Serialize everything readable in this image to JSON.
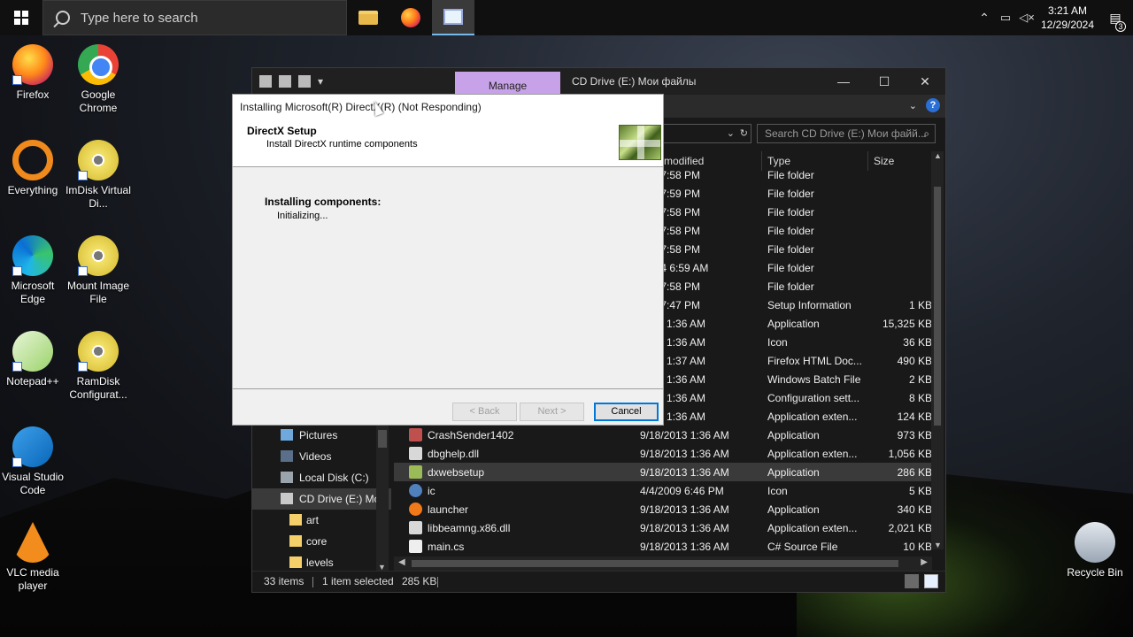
{
  "taskbar": {
    "search_placeholder": "Type here to search",
    "time": "3:21 AM",
    "date": "12/29/2024",
    "notification_count": "3"
  },
  "desktop_icons": [
    {
      "label": "Firefox",
      "icon": "firefox-icon"
    },
    {
      "label": "Google Chrome",
      "icon": "chrome-icon"
    },
    {
      "label": "Everything",
      "icon": "everything-icon"
    },
    {
      "label": "ImDisk Virtual Di...",
      "icon": "disc-icon"
    },
    {
      "label": "Microsoft Edge",
      "icon": "edge-icon"
    },
    {
      "label": "Mount Image File",
      "icon": "disc-icon"
    },
    {
      "label": "Notepad++",
      "icon": "notepad-icon"
    },
    {
      "label": "RamDisk Configurat...",
      "icon": "disc-icon"
    },
    {
      "label": "Visual Studio Code",
      "icon": "vscode-icon"
    },
    {
      "label": "VLC media player",
      "icon": "vlc-icon"
    },
    {
      "label": "Recycle Bin",
      "icon": "recycle-bin-icon"
    }
  ],
  "explorer": {
    "manage_tab": "Manage",
    "title": "CD Drive (E:) Мои файлы",
    "search_placeholder": "Search CD Drive (E:) Мои файй...",
    "columns": {
      "modified": "modified",
      "type": "Type",
      "size": "Size"
    },
    "files": [
      {
        "name": "",
        "date": "021 7:58 PM",
        "type": "File folder",
        "size": ""
      },
      {
        "name": "",
        "date": "021 7:59 PM",
        "type": "File folder",
        "size": ""
      },
      {
        "name": "",
        "date": "021 7:58 PM",
        "type": "File folder",
        "size": ""
      },
      {
        "name": "",
        "date": "021 7:58 PM",
        "type": "File folder",
        "size": ""
      },
      {
        "name": "",
        "date": "021 7:58 PM",
        "type": "File folder",
        "size": ""
      },
      {
        "name": "",
        "date": "/2024 6:59 AM",
        "type": "File folder",
        "size": ""
      },
      {
        "name": "",
        "date": "021 7:58 PM",
        "type": "File folder",
        "size": ""
      },
      {
        "name": "",
        "date": "021 7:47 PM",
        "type": "Setup Information",
        "size": "1 KB"
      },
      {
        "name": "",
        "date": "2013 1:36 AM",
        "type": "Application",
        "size": "15,325 KB"
      },
      {
        "name": "",
        "date": "2013 1:36 AM",
        "type": "Icon",
        "size": "36 KB"
      },
      {
        "name": "",
        "date": "2013 1:37 AM",
        "type": "Firefox HTML Doc...",
        "size": "490 KB"
      },
      {
        "name": "",
        "date": "2013 1:36 AM",
        "type": "Windows Batch File",
        "size": "2 KB"
      },
      {
        "name": "",
        "date": "2013 1:36 AM",
        "type": "Configuration sett...",
        "size": "8 KB"
      },
      {
        "name": "",
        "date": "2013 1:36 AM",
        "type": "Application exten...",
        "size": "124 KB"
      },
      {
        "name": "CrashSender1402",
        "date": "9/18/2013 1:36 AM",
        "type": "Application",
        "size": "973 KB"
      },
      {
        "name": "dbghelp.dll",
        "date": "9/18/2013 1:36 AM",
        "type": "Application exten...",
        "size": "1,056 KB"
      },
      {
        "name": "dxwebsetup",
        "date": "9/18/2013 1:36 AM",
        "type": "Application",
        "size": "286 KB"
      },
      {
        "name": "ic",
        "date": "4/4/2009 6:46 PM",
        "type": "Icon",
        "size": "5 KB"
      },
      {
        "name": "launcher",
        "date": "9/18/2013 1:36 AM",
        "type": "Application",
        "size": "340 KB"
      },
      {
        "name": "libbeamng.x86.dll",
        "date": "9/18/2013 1:36 AM",
        "type": "Application exten...",
        "size": "2,021 KB"
      },
      {
        "name": "main.cs",
        "date": "9/18/2013 1:36 AM",
        "type": "C# Source File",
        "size": "10 KB"
      }
    ],
    "nav": [
      {
        "label": "Pictures"
      },
      {
        "label": "Videos"
      },
      {
        "label": "Local Disk (C:)"
      },
      {
        "label": "CD Drive (E:) Mo"
      },
      {
        "label": "art"
      },
      {
        "label": "core"
      },
      {
        "label": "levels"
      }
    ],
    "status": {
      "count": "33 items",
      "selected": "1 item selected",
      "size": "285 KB"
    }
  },
  "dialog": {
    "title": "Installing Microsoft(R) DirectX(R) (Not Responding)",
    "header_title": "DirectX Setup",
    "header_subtitle": "Install DirectX runtime components",
    "status_title": "Installing components:",
    "status_detail": "Initializing...",
    "back_label": "< Back",
    "next_label": "Next >",
    "cancel_label": "Cancel"
  }
}
